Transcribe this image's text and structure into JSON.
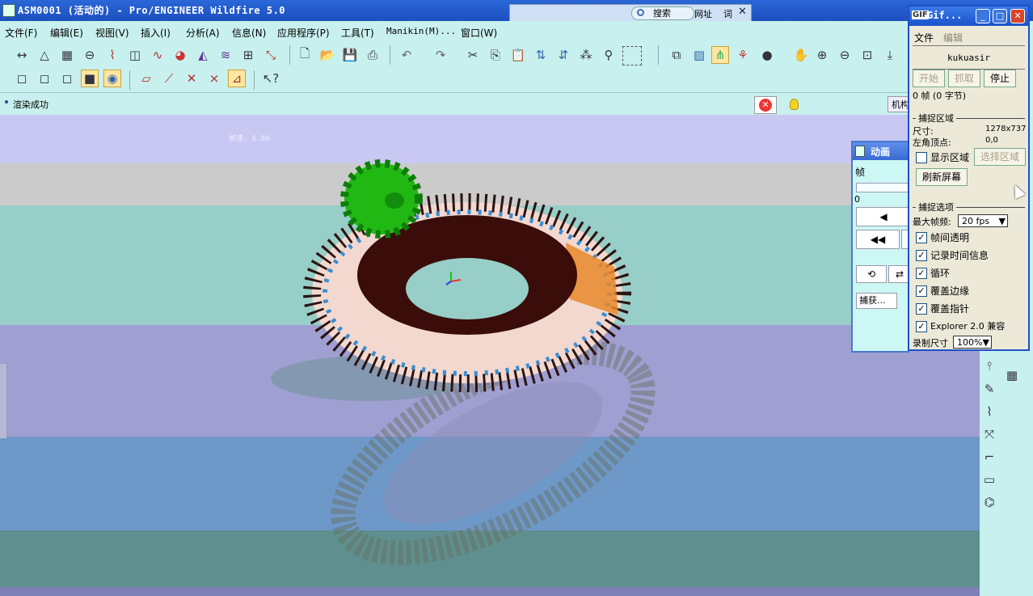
{
  "window": {
    "title": "ASM0001 (活动的) - Pro/ENGINEER Wildfire 5.0"
  },
  "menu": [
    "文件(F)",
    "编辑(E)",
    "视图(V)",
    "插入(I)",
    "分析(A)",
    "信息(N)",
    "应用程序(P)",
    "工具(T)",
    "Manikin(M)...",
    "窗口(W)"
  ],
  "status": {
    "message": "渲染成功",
    "mechanism_tab": "机构"
  },
  "viewport": {
    "fps_overlay": "帧速: 6.80",
    "stripes": [
      "#c9c8f3",
      "#cbcbcb",
      "#98cec8",
      "#9f9fd2",
      "#6e98c8",
      "#5f8f8f",
      "#8080b8"
    ]
  },
  "search": {
    "search_label": "搜索",
    "url_label": "网址",
    "word_label": "词"
  },
  "gif_window": {
    "title": "Gif...",
    "menu": [
      "文件",
      "编辑"
    ],
    "user": "kukuasir",
    "start": "开始",
    "capture": "抓取",
    "stop": "停止",
    "frames": "0 帧 (0 字节)",
    "capture_area_header": "捕捉区域",
    "size_label": "尺寸:",
    "size_value": "1278x737",
    "corner_label": "左角顶点:",
    "corner_value": "0,0",
    "show_area": "显示区域",
    "select_area": "选择区域",
    "refresh": "刷新屏幕",
    "options_header": "捕捉选项",
    "max_fps_label": "最大帧频:",
    "max_fps_value": "20 fps",
    "options": [
      {
        "label": "帧间透明",
        "checked": true
      },
      {
        "label": "记录时间信息",
        "checked": true
      },
      {
        "label": "循环",
        "checked": true
      },
      {
        "label": "覆盖边缘",
        "checked": true
      },
      {
        "label": "覆盖指针",
        "checked": true
      },
      {
        "label": "Explorer 2.0 兼容",
        "checked": true
      }
    ],
    "record_size_label": "录制尺寸",
    "record_size_value": "100%"
  },
  "anim_panel": {
    "title": "动画",
    "frame_label": "帧",
    "frame_value": "0",
    "capture_button": "捕获..."
  },
  "colors": {
    "title_bar": "#1d4fbf",
    "ui_background": "#c8f0ee",
    "gear_green": "#22b814",
    "gear_face": "#3a0d0a"
  }
}
